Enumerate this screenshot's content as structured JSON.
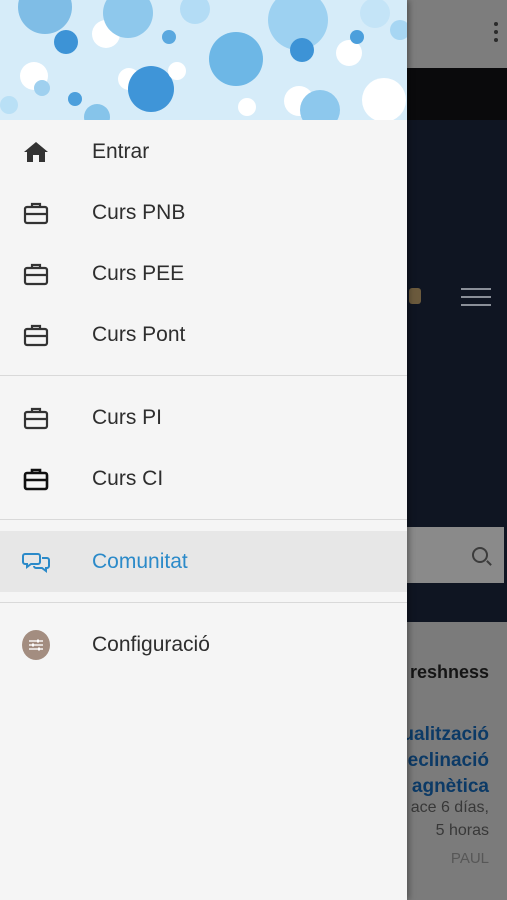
{
  "background": {
    "section_heading": "reshness",
    "news_title_lines": [
      "ctualització",
      "eclinació",
      "agnètica"
    ],
    "time_lines": [
      "ace 6 días,",
      "5 horas"
    ],
    "author": "PAUL"
  },
  "drawer": {
    "groups": [
      [
        {
          "label": "Entrar",
          "icon": "home-icon"
        },
        {
          "label": "Curs PNB",
          "icon": "briefcase-icon"
        },
        {
          "label": "Curs PEE",
          "icon": "briefcase-icon"
        },
        {
          "label": "Curs Pont",
          "icon": "briefcase-icon"
        }
      ],
      [
        {
          "label": "Curs PI",
          "icon": "briefcase-icon"
        },
        {
          "label": "Curs CI",
          "icon": "briefcase-icon"
        }
      ],
      [
        {
          "label": "Comunitat",
          "icon": "chat-icon",
          "active": true
        }
      ],
      [
        {
          "label": "Configuració",
          "icon": "settings-icon"
        }
      ]
    ]
  },
  "colors": {
    "accent": "#2b8ac9",
    "header_bg": "#d6ecf9",
    "drawer_bg": "#f5f5f5",
    "active_row_bg": "#e7e7e7",
    "settings_icon_bg": "#a38d80"
  }
}
